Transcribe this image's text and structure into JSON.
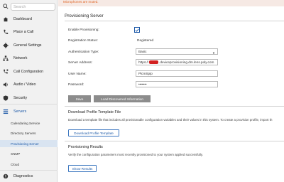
{
  "sidebar": {
    "search_placeholder": "Search",
    "items": [
      {
        "label": "Dashboard",
        "icon": "home-icon"
      },
      {
        "label": "Place a Call",
        "icon": "phone-icon"
      },
      {
        "label": "General Settings",
        "icon": "gear-icon"
      },
      {
        "label": "Network",
        "icon": "network-icon"
      },
      {
        "label": "Call Configuration",
        "icon": "call-config-icon"
      },
      {
        "label": "Audio / Video",
        "icon": "speaker-icon"
      },
      {
        "label": "Security",
        "icon": "shield-icon"
      },
      {
        "label": "Servers",
        "icon": "servers-icon"
      },
      {
        "label": "Diagnostics",
        "icon": "diagnostics-icon"
      }
    ],
    "subitems": [
      {
        "label": "Calendaring Service"
      },
      {
        "label": "Directory Servers"
      },
      {
        "label": "Provisioning Server"
      },
      {
        "label": "SNMP"
      },
      {
        "label": "Cloud"
      }
    ]
  },
  "alert": {
    "text": "Microphones are muted."
  },
  "page_title": "Provisioning Server",
  "form": {
    "enable_label": "Enable Provisioning:",
    "enable_checked": true,
    "status_label": "Registration Status:",
    "status_value": "Registered",
    "auth_label": "Authentication Type:",
    "auth_value": "Basic",
    "server_label": "Server Address:",
    "server_prefix": "https://",
    "server_suffix": ".deviceprovisioning.dm.lens.poly.com",
    "user_label": "User Name:",
    "user_value": "PlcmSpip",
    "password_label": "Password:",
    "password_value": "•••••••"
  },
  "buttons": {
    "save": "Save",
    "load": "Load Discovered Information"
  },
  "download": {
    "title": "Download Profile Template File",
    "description": "Download a template file that includes all provisionable configuration variables and their values in this system. To create a provision profile, import th",
    "button": "Download Profile Template"
  },
  "results": {
    "title": "Provisioning Results",
    "description": "Verify the configuration parameters most recently provisioned to your system applied successfully.",
    "button": "Show Results"
  },
  "colors": {
    "accent": "#1e5aa8",
    "alert": "#e0682a",
    "selected_bg": "#d9e4f1"
  }
}
